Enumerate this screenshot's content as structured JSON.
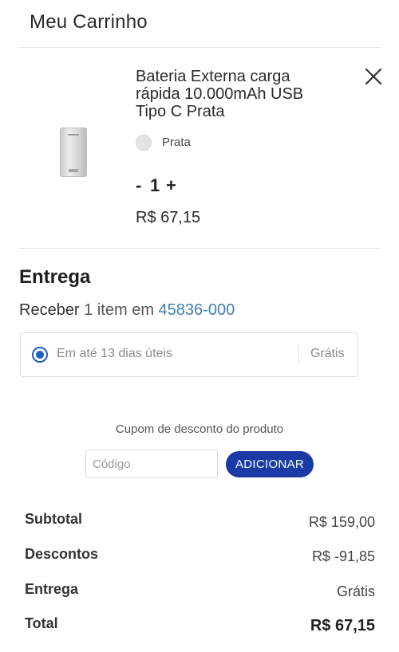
{
  "header": {
    "title": "Meu Carrinho"
  },
  "cart_item": {
    "name": "Bateria Externa carga rápida 10.000mAh USB Tipo C Prata",
    "color": "Prata",
    "quantity": "1",
    "minus_label": "-",
    "plus_label": "+",
    "price": "R$ 67,15",
    "swatch_color": "#e3e3e3"
  },
  "delivery": {
    "heading": "Entrega",
    "receive_label": "Receber",
    "items_text": "1 item em",
    "cep": "45836-000",
    "option": {
      "label": "Em até 13 dias úteis",
      "price": "Grátis",
      "selected": true
    }
  },
  "coupon": {
    "label": "Cupom de desconto do produto",
    "placeholder": "Código",
    "button": "ADICIONAR"
  },
  "summary": {
    "subtotal_label": "Subtotal",
    "subtotal_value": "R$ 159,00",
    "discount_label": "Descontos",
    "discount_value": "R$ -91,85",
    "shipping_label": "Entrega",
    "shipping_value": "Grátis",
    "total_label": "Total",
    "total_value": "R$ 67,15"
  },
  "colors": {
    "accent": "#1a3aa6",
    "radio": "#1f5fbf",
    "link": "#3d7fb3"
  }
}
